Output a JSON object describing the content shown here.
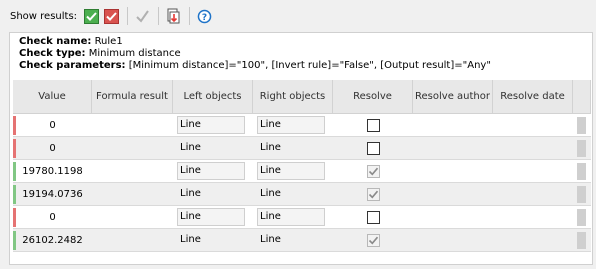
{
  "toolbar": {
    "show_results_label": "Show results:",
    "icons": [
      "show-passed-checkbox-icon",
      "show-failed-checkbox-icon",
      "resolve-checkmark-icon",
      "export-document-icon",
      "help-icon"
    ],
    "colors": {
      "passed": "#4caf50",
      "failed": "#d9534f",
      "help": "#1e73c8"
    }
  },
  "info": {
    "check_name_label": "Check name:",
    "check_name": "Rule1",
    "check_type_label": "Check type:",
    "check_type": "Minimum distance",
    "check_params_label": "Check parameters:",
    "check_params": "[Minimum distance]=\"100\", [Invert rule]=\"False\", [Output result]=\"Any\""
  },
  "table": {
    "headers": [
      "Value",
      "Formula result",
      "Left objects",
      "Right objects",
      "Resolve",
      "Resolve author",
      "Resolve date"
    ],
    "rows": [
      {
        "value": "0",
        "status": "fail",
        "formula": "",
        "left": "Line",
        "right": "Line",
        "resolved": false,
        "editable": true
      },
      {
        "value": "0",
        "status": "fail",
        "formula": "",
        "left": "Line",
        "right": "Line",
        "resolved": false,
        "editable": false
      },
      {
        "value": "19780.1198",
        "status": "pass",
        "formula": "",
        "left": "Line",
        "right": "Line",
        "resolved": true,
        "editable": true
      },
      {
        "value": "19194.0736",
        "status": "pass",
        "formula": "",
        "left": "Line",
        "right": "Line",
        "resolved": true,
        "editable": false
      },
      {
        "value": "0",
        "status": "fail",
        "formula": "",
        "left": "Line",
        "right": "Line",
        "resolved": false,
        "editable": true
      },
      {
        "value": "26102.2482",
        "status": "pass",
        "formula": "",
        "left": "Line",
        "right": "Line",
        "resolved": true,
        "editable": false
      }
    ],
    "status_colors": {
      "fail": "#e57373",
      "pass": "#81c784"
    }
  }
}
